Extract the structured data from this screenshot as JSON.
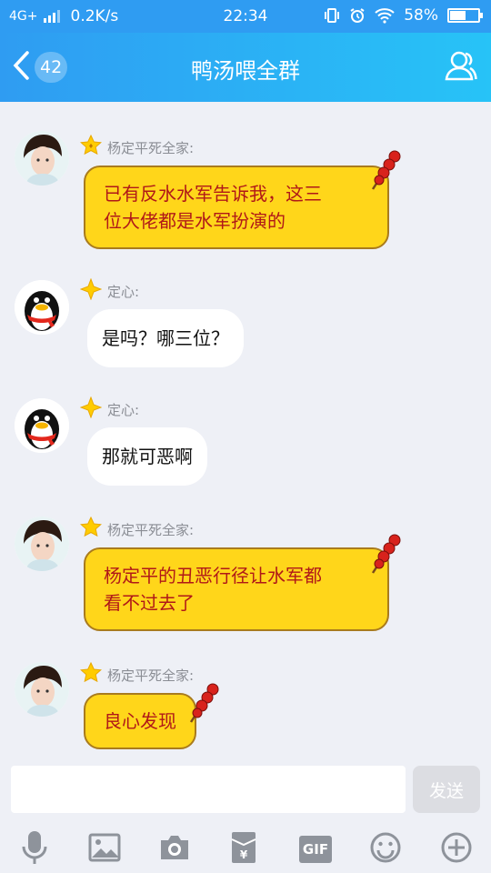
{
  "status_bar": {
    "network": "4G+",
    "speed": "0.2K/s",
    "time": "22:34",
    "battery": "58%",
    "battery_level": 0.58
  },
  "header": {
    "back_count": "42",
    "title": "鸭汤喂全群"
  },
  "messages": [
    {
      "sender": "杨定平死全家:",
      "text_lines": [
        "已有反水水军告诉我，这三",
        "位大佬都是水军扮演的"
      ],
      "style": "yellow"
    },
    {
      "sender": "定心:",
      "text": "是吗？哪三位？",
      "style": "white"
    },
    {
      "sender": "定心:",
      "text": "那就可恶啊",
      "style": "white"
    },
    {
      "sender": "杨定平死全家:",
      "text_lines": [
        "杨定平的丑恶行径让水军都",
        "看不过去了"
      ],
      "style": "yellow"
    },
    {
      "sender": "杨定平死全家:",
      "text_lines": [
        "良心发现"
      ],
      "style": "yellow"
    }
  ],
  "input": {
    "placeholder": "",
    "send_label": "发送"
  },
  "toolbar": {
    "gif_label": "GIF",
    "items": [
      "mic-icon",
      "image-icon",
      "camera-icon",
      "red-packet-icon",
      "gif-icon",
      "emoji-icon",
      "plus-icon"
    ]
  },
  "colors": {
    "header_start": "#2f9cf2",
    "header_end": "#27c3f7",
    "bubble_yellow": "#ffd61a",
    "bubble_text_red": "#b01818",
    "background": "#eef0f6"
  }
}
